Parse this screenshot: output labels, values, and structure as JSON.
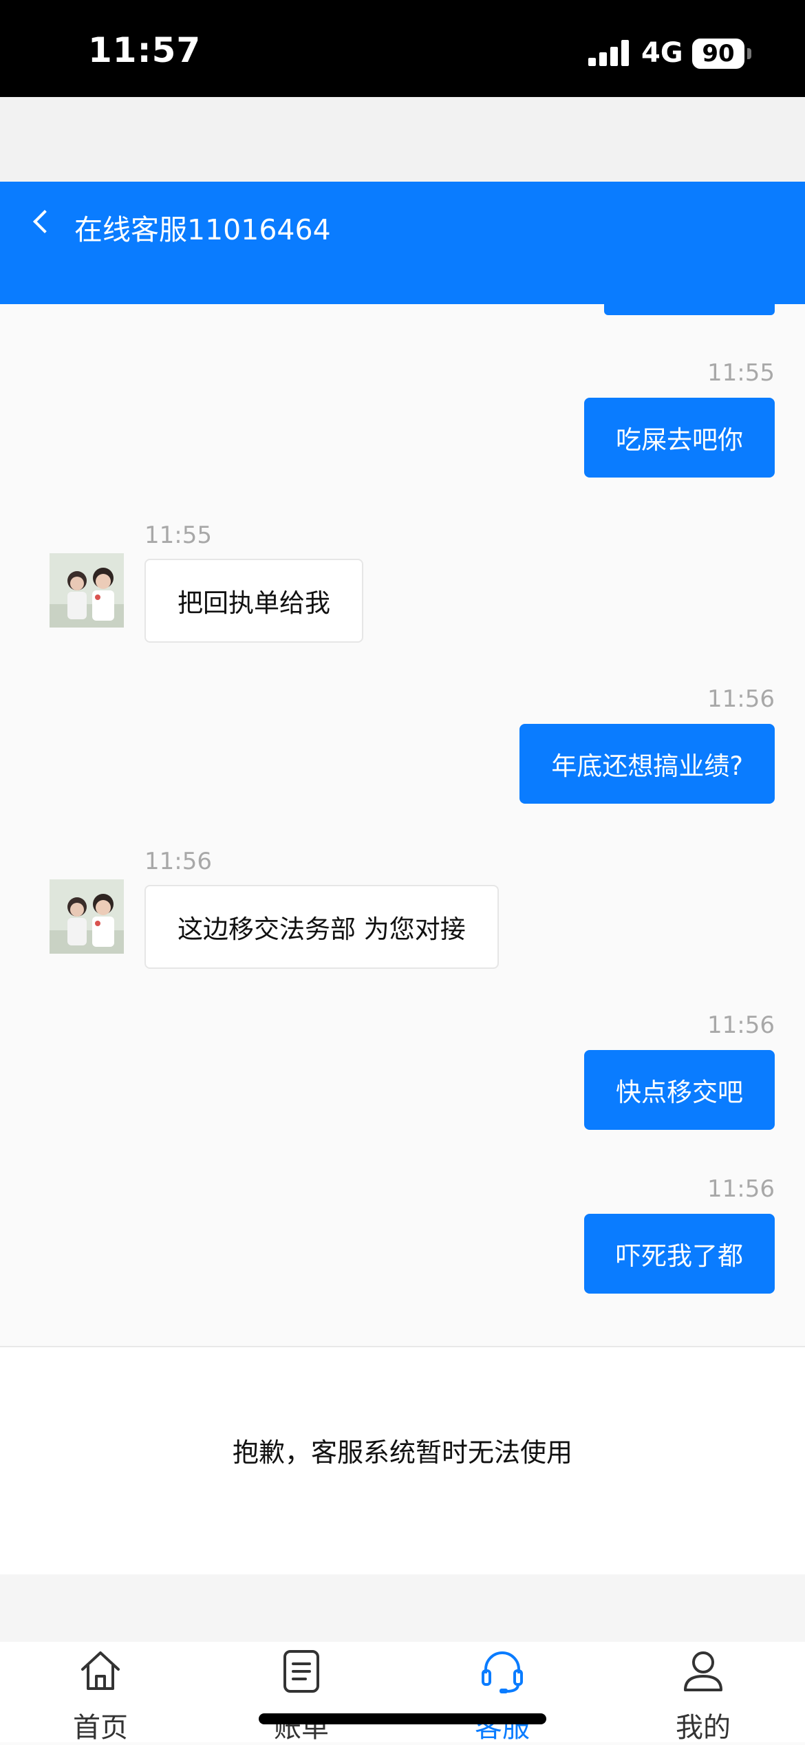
{
  "status_bar": {
    "time": "11:57",
    "network": "4G",
    "battery": "90"
  },
  "header": {
    "title": "在线客服11016464",
    "back_icon": "chevron-left-icon"
  },
  "messages": [
    {
      "side": "out",
      "time": "11:55",
      "text": "吃屎去吧你"
    },
    {
      "side": "in",
      "time": "11:55",
      "text": "把回执单给我"
    },
    {
      "side": "out",
      "time": "11:56",
      "text": "年底还想搞业绩?"
    },
    {
      "side": "in",
      "time": "11:56",
      "text": "这边移交法务部 为您对接"
    },
    {
      "side": "out",
      "time": "11:56",
      "text": "快点移交吧"
    },
    {
      "side": "out",
      "time": "11:56",
      "text": "吓死我了都"
    }
  ],
  "notice": "抱歉，客服系统暂时无法使用",
  "tabbar": [
    {
      "label": "首页",
      "icon": "home-icon",
      "active": false
    },
    {
      "label": "账单",
      "icon": "bill-icon",
      "active": false
    },
    {
      "label": "客服",
      "icon": "headset-icon",
      "active": true
    },
    {
      "label": "我的",
      "icon": "user-icon",
      "active": false
    }
  ],
  "colors": {
    "accent": "#0a7cff",
    "background": "#fafafa"
  }
}
